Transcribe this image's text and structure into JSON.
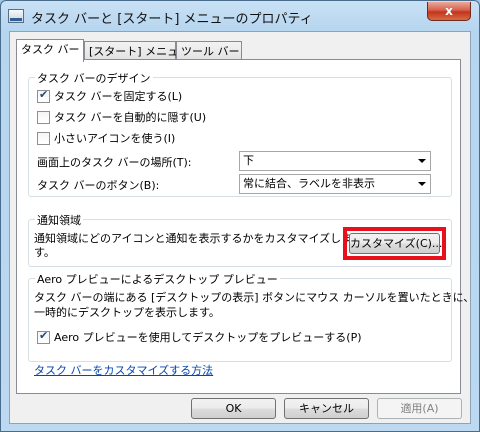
{
  "window": {
    "title": "タスク バーと [スタート] メニューのプロパティ",
    "close_symbol": "x"
  },
  "tabs": [
    {
      "label": "タスク バー",
      "active": true
    },
    {
      "label": "[スタート] メニュー",
      "active": false
    },
    {
      "label": "ツール バー",
      "active": false
    }
  ],
  "taskbar_design": {
    "title": "タスク バーのデザイン",
    "options": [
      {
        "label": "タスク バーを固定する(L)",
        "checked": true
      },
      {
        "label": "タスク バーを自動的に隠す(U)",
        "checked": false
      },
      {
        "label": "小さいアイコンを使う(I)",
        "checked": false
      }
    ],
    "location_label": "画面上のタスク バーの場所(T):",
    "location_value": "下",
    "buttons_label": "タスク バーのボタン(B):",
    "buttons_value": "常に結合、ラベルを非表示"
  },
  "notification_area": {
    "title": "通知領域",
    "description_line1": "通知領域にどのアイコンと通知を表示するかをカスタマイズしま",
    "description_line2": "す。",
    "customize_button": "カスタマイズ(C)..."
  },
  "aero_peek": {
    "title": "Aero プレビューによるデスクトップ プレビュー",
    "description_line1": "タスク バーの端にある [デスクトップの表示] ボタンにマウス カーソルを置いたときに、",
    "description_line2": "一時的にデスクトップを表示します。",
    "checkbox_label": "Aero プレビューを使用してデスクトップをプレビューする(P)",
    "checked": true
  },
  "help_link": "タスク バーをカスタマイズする方法",
  "footer": {
    "ok": "OK",
    "cancel": "キャンセル",
    "apply": "適用(A)"
  },
  "colors": {
    "highlight": "#e8101b",
    "link": "#0645ad"
  }
}
